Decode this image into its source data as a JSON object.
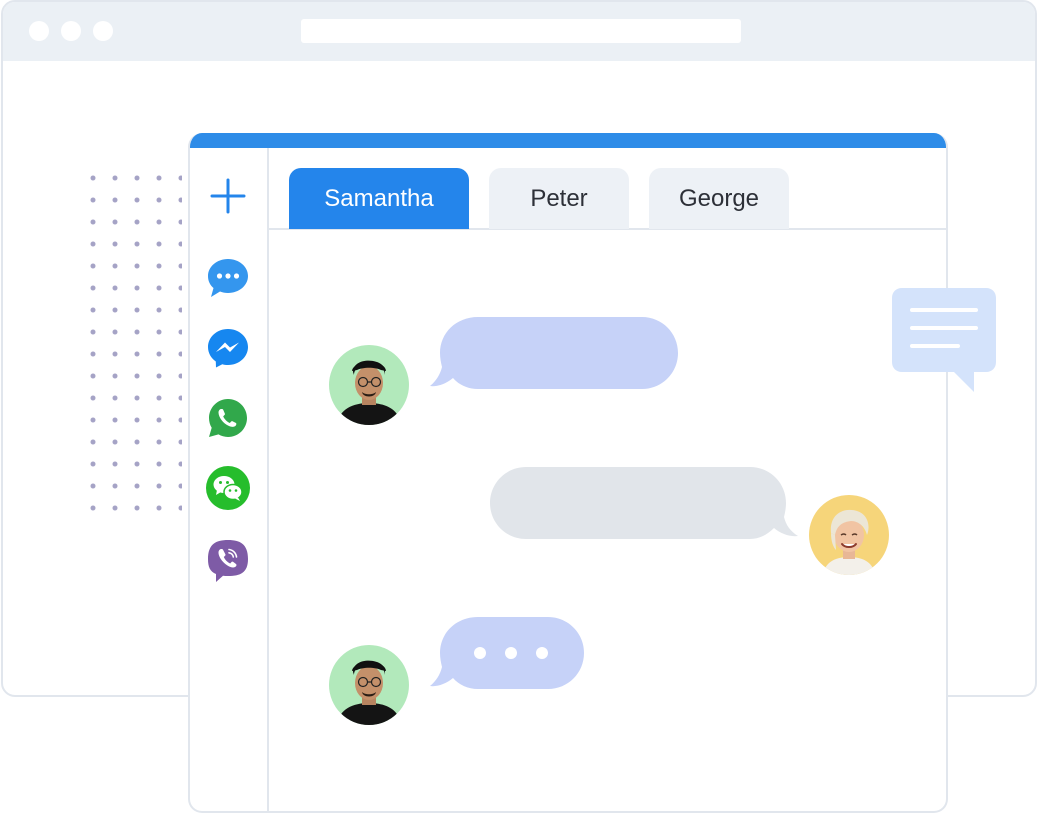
{
  "colors": {
    "accent": "#2e8ce8",
    "tab_active": "#2485eb",
    "bubble_incoming": "#c6d2f8",
    "bubble_outgoing": "#e1e5ea",
    "avatar_male_bg": "#b2e9bb",
    "avatar_female_bg": "#f6d57a"
  },
  "browser": {
    "window_buttons": [
      "dot",
      "dot",
      "dot"
    ]
  },
  "sidebar": {
    "items": [
      {
        "icon": "plus-icon",
        "name": "add-channel-button"
      },
      {
        "icon": "chat-bubble-icon",
        "name": "chat-app-button"
      },
      {
        "icon": "messenger-icon",
        "name": "messenger-app-button"
      },
      {
        "icon": "whatsapp-icon",
        "name": "whatsapp-app-button"
      },
      {
        "icon": "wechat-icon",
        "name": "wechat-app-button"
      },
      {
        "icon": "viber-icon",
        "name": "viber-app-button"
      }
    ]
  },
  "tabs": [
    {
      "label": "Samantha",
      "active": true
    },
    {
      "label": "Peter",
      "active": false
    },
    {
      "label": "George",
      "active": false
    }
  ],
  "messages": [
    {
      "from": "contact",
      "type": "text-placeholder"
    },
    {
      "from": "user",
      "type": "text-placeholder"
    },
    {
      "from": "contact",
      "type": "typing-indicator"
    }
  ],
  "floating_note": {
    "icon": "message-note-icon"
  }
}
